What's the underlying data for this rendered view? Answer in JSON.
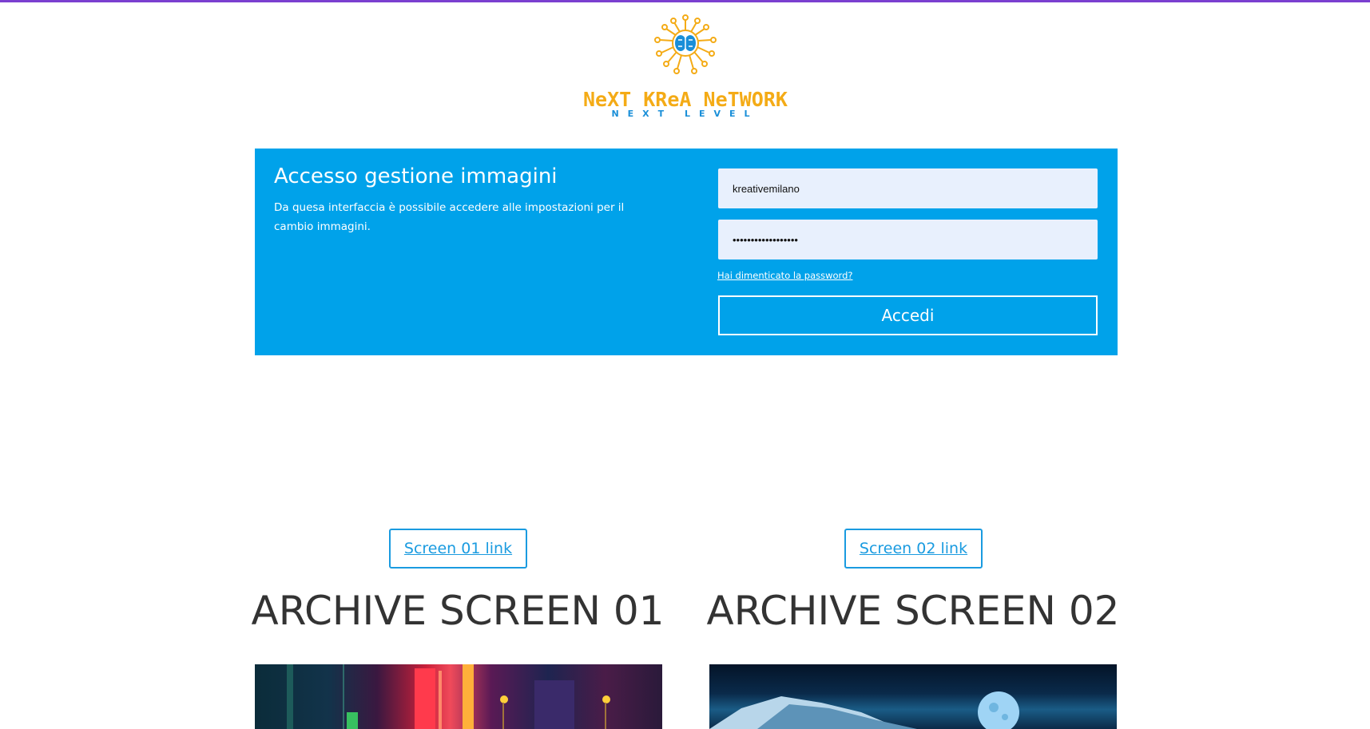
{
  "logo": {
    "title": "NeXT KReA NeTWORK",
    "subtitle": "NEXT LEVEL",
    "primary_color": "#f4ab16",
    "secondary_color": "#1a8fd8",
    "icon": "brain-circuit-icon"
  },
  "login": {
    "title": "Accesso gestione immagini",
    "description": "Da quesa interfaccia è possibile accedere alle impostazioni per il cambio immagini.",
    "username_value": "kreativemilano",
    "password_value": "••••••••••••••••••",
    "forgot_label": "Hai dimenticato la password?",
    "submit_label": "Accedi",
    "panel_color": "#00a2ea"
  },
  "screens": [
    {
      "link_label": "Screen 01 link",
      "title": "ARCHIVE SCREEN 01",
      "thumbnail": "neon-city-image"
    },
    {
      "link_label": "Screen 02 link",
      "title": "ARCHIVE SCREEN 02",
      "thumbnail": "mountain-moon-image"
    }
  ],
  "colors": {
    "top_bar": "#7b3fd0",
    "link_accent": "#1a9be0",
    "heading_text": "#333333"
  }
}
